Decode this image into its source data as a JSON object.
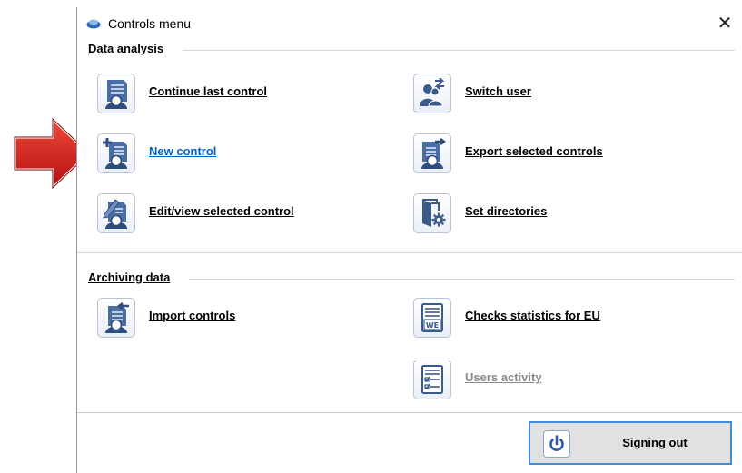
{
  "window": {
    "title": "Controls menu",
    "close_symbol": "✕"
  },
  "sections": {
    "data_analysis": {
      "label": "Data analysis",
      "items": [
        {
          "label": "Continue last control",
          "icon": "document-user-icon"
        },
        {
          "label": "Switch user",
          "icon": "switch-user-icon"
        },
        {
          "label": "New control",
          "icon": "new-document-icon"
        },
        {
          "label": "Export selected controls",
          "icon": "export-document-icon"
        },
        {
          "label": "Edit/view selected control",
          "icon": "edit-document-icon"
        },
        {
          "label": "Set directories",
          "icon": "folder-gear-icon"
        }
      ]
    },
    "archiving_data": {
      "label": "Archiving data",
      "items": [
        {
          "label": "Import controls",
          "icon": "import-document-icon"
        },
        {
          "label": "Checks statistics for EU",
          "icon": "we-statistics-icon"
        },
        {
          "label": "Users activity",
          "icon": "checklist-icon",
          "disabled": true
        }
      ]
    }
  },
  "footer": {
    "signout_label": "Signing out",
    "signout_icon": "power-icon"
  },
  "colors": {
    "link": "#0063c8",
    "disabled": "#8a8a8a",
    "icon_blue": "#3a5a8c",
    "arrow_red": "#d11a1a",
    "button_border": "#3c8dd6"
  }
}
